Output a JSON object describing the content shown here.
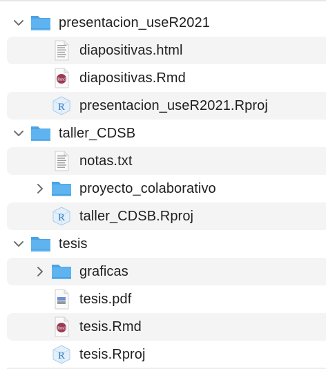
{
  "items": [
    {
      "name": "presentacion_useR2021",
      "type": "folder",
      "level": 0,
      "expanded": true
    },
    {
      "name": "diapositivas.html",
      "type": "html",
      "level": 1
    },
    {
      "name": "diapositivas.Rmd",
      "type": "rmd",
      "level": 1
    },
    {
      "name": "presentacion_useR2021.Rproj",
      "type": "rproj",
      "level": 1
    },
    {
      "name": "taller_CDSB",
      "type": "folder",
      "level": 0,
      "expanded": true
    },
    {
      "name": "notas.txt",
      "type": "txt",
      "level": 1
    },
    {
      "name": "proyecto_colaborativo",
      "type": "folder",
      "level": 1,
      "expanded": false
    },
    {
      "name": "taller_CDSB.Rproj",
      "type": "rproj",
      "level": 1
    },
    {
      "name": "tesis",
      "type": "folder",
      "level": 0,
      "expanded": true
    },
    {
      "name": "graficas",
      "type": "folder",
      "level": 1,
      "expanded": false
    },
    {
      "name": "tesis.pdf",
      "type": "pdf",
      "level": 1
    },
    {
      "name": "tesis.Rmd",
      "type": "rmd",
      "level": 1
    },
    {
      "name": "tesis.Rproj",
      "type": "rproj",
      "level": 1
    }
  ],
  "icon_labels": {
    "rmd": "Rmd",
    "rproj": "R"
  },
  "colors": {
    "folder": "#5fb4f0",
    "folder_tab": "#4aa3e6",
    "rmd": "#9b3b55",
    "stripe": "#f4f4f4"
  }
}
